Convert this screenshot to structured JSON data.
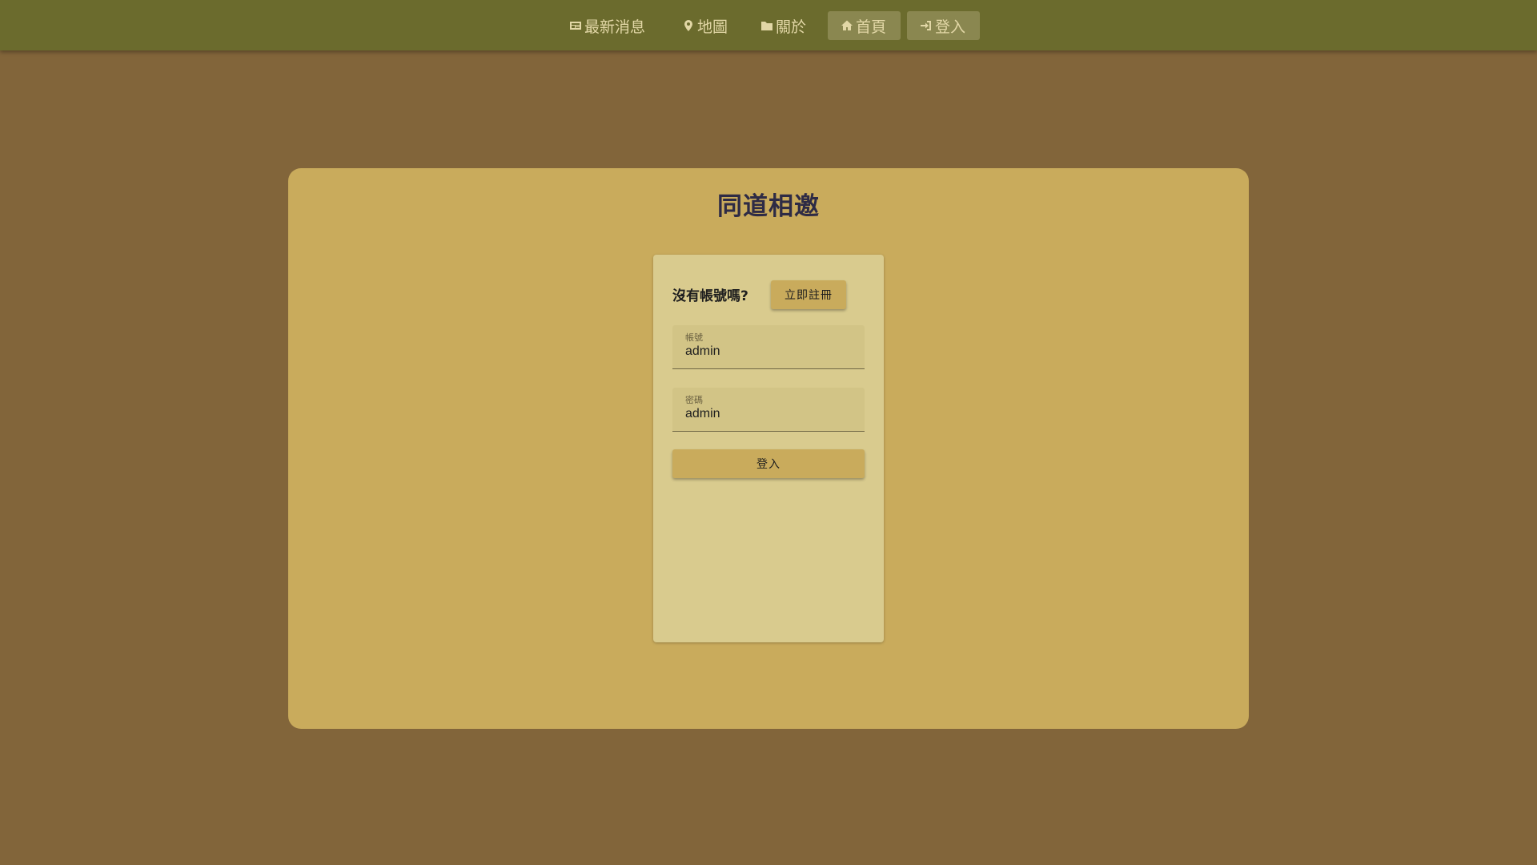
{
  "nav": {
    "news": {
      "label": "最新消息",
      "icon": "newspaper-icon"
    },
    "map": {
      "label": "地圖",
      "icon": "map-pin-icon"
    },
    "about": {
      "label": "關於",
      "icon": "folder-icon"
    },
    "home": {
      "label": "首頁",
      "icon": "home-icon"
    },
    "login": {
      "label": "登入",
      "icon": "login-icon"
    }
  },
  "main": {
    "title": "同道相邀"
  },
  "login_form": {
    "no_account_text": "沒有帳號嗎?",
    "register_label": "立即註冊",
    "username": {
      "label": "帳號",
      "value": "admin"
    },
    "password": {
      "label": "密碼",
      "value": "admin"
    },
    "submit_label": "登入"
  },
  "colors": {
    "page_background": "#82653a",
    "topbar": "#6b6b2d",
    "card": "#c9ab5c",
    "panel": "#d9cb8e",
    "nav_text": "#e2d7a6",
    "title_text": "#2e2b45"
  }
}
